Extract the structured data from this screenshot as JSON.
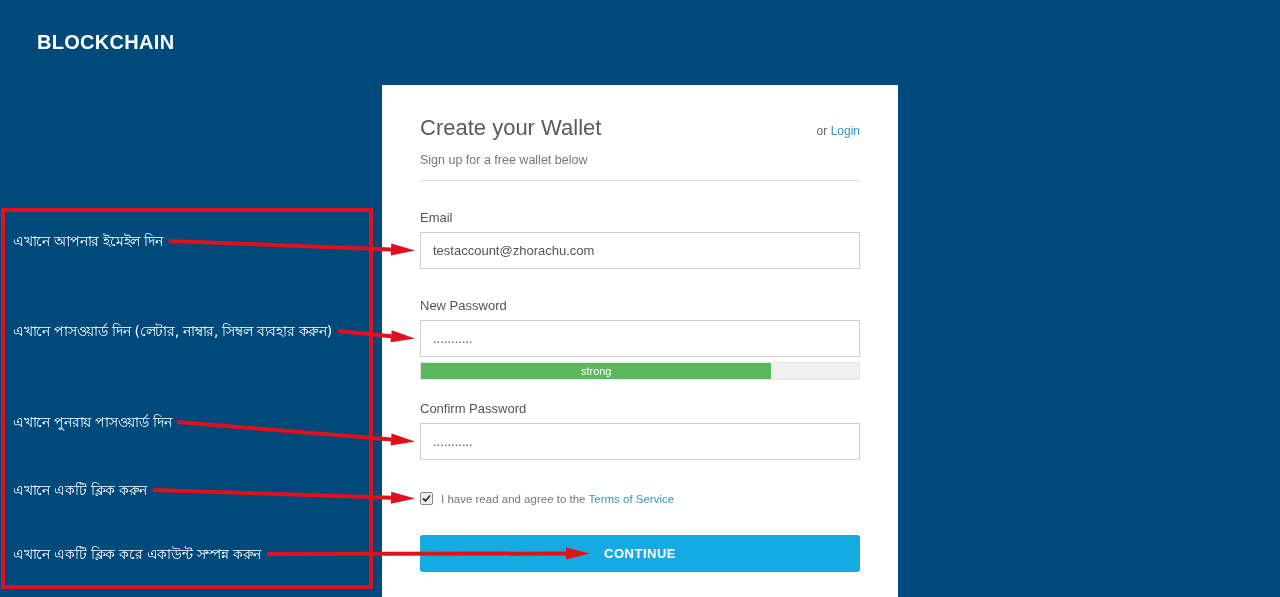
{
  "logo": "BLOCKCHAIN",
  "annotations": [
    "এখানে আপনার ইমেইল দিন",
    "এখানে পাসওয়ার্ড দিন (লেটার, নাম্বার, সিম্বল ব্যবহার করুন)",
    "এখানে পুনরায় পাসওয়ার্ড দিন",
    "এখানে একটি ক্লিক করুন",
    "এখানে একটি ক্লিক করে একাউন্ট সম্পন্ন করুন"
  ],
  "card": {
    "title": "Create your Wallet",
    "login_prefix": "or",
    "login_link": "Login",
    "subtitle": "Sign up for a free wallet below",
    "fields": [
      {
        "label": "Email",
        "value": "testaccount@zhorachu.com"
      },
      {
        "label": "New Password",
        "value": "...........",
        "strength": {
          "label": "strong",
          "level": 0.8
        }
      },
      {
        "label": "Confirm Password",
        "value": "..........."
      }
    ],
    "agree": {
      "checked": true,
      "text": "I have read and agree to the",
      "link": "Terms of Service"
    },
    "button": "CONTINUE"
  }
}
